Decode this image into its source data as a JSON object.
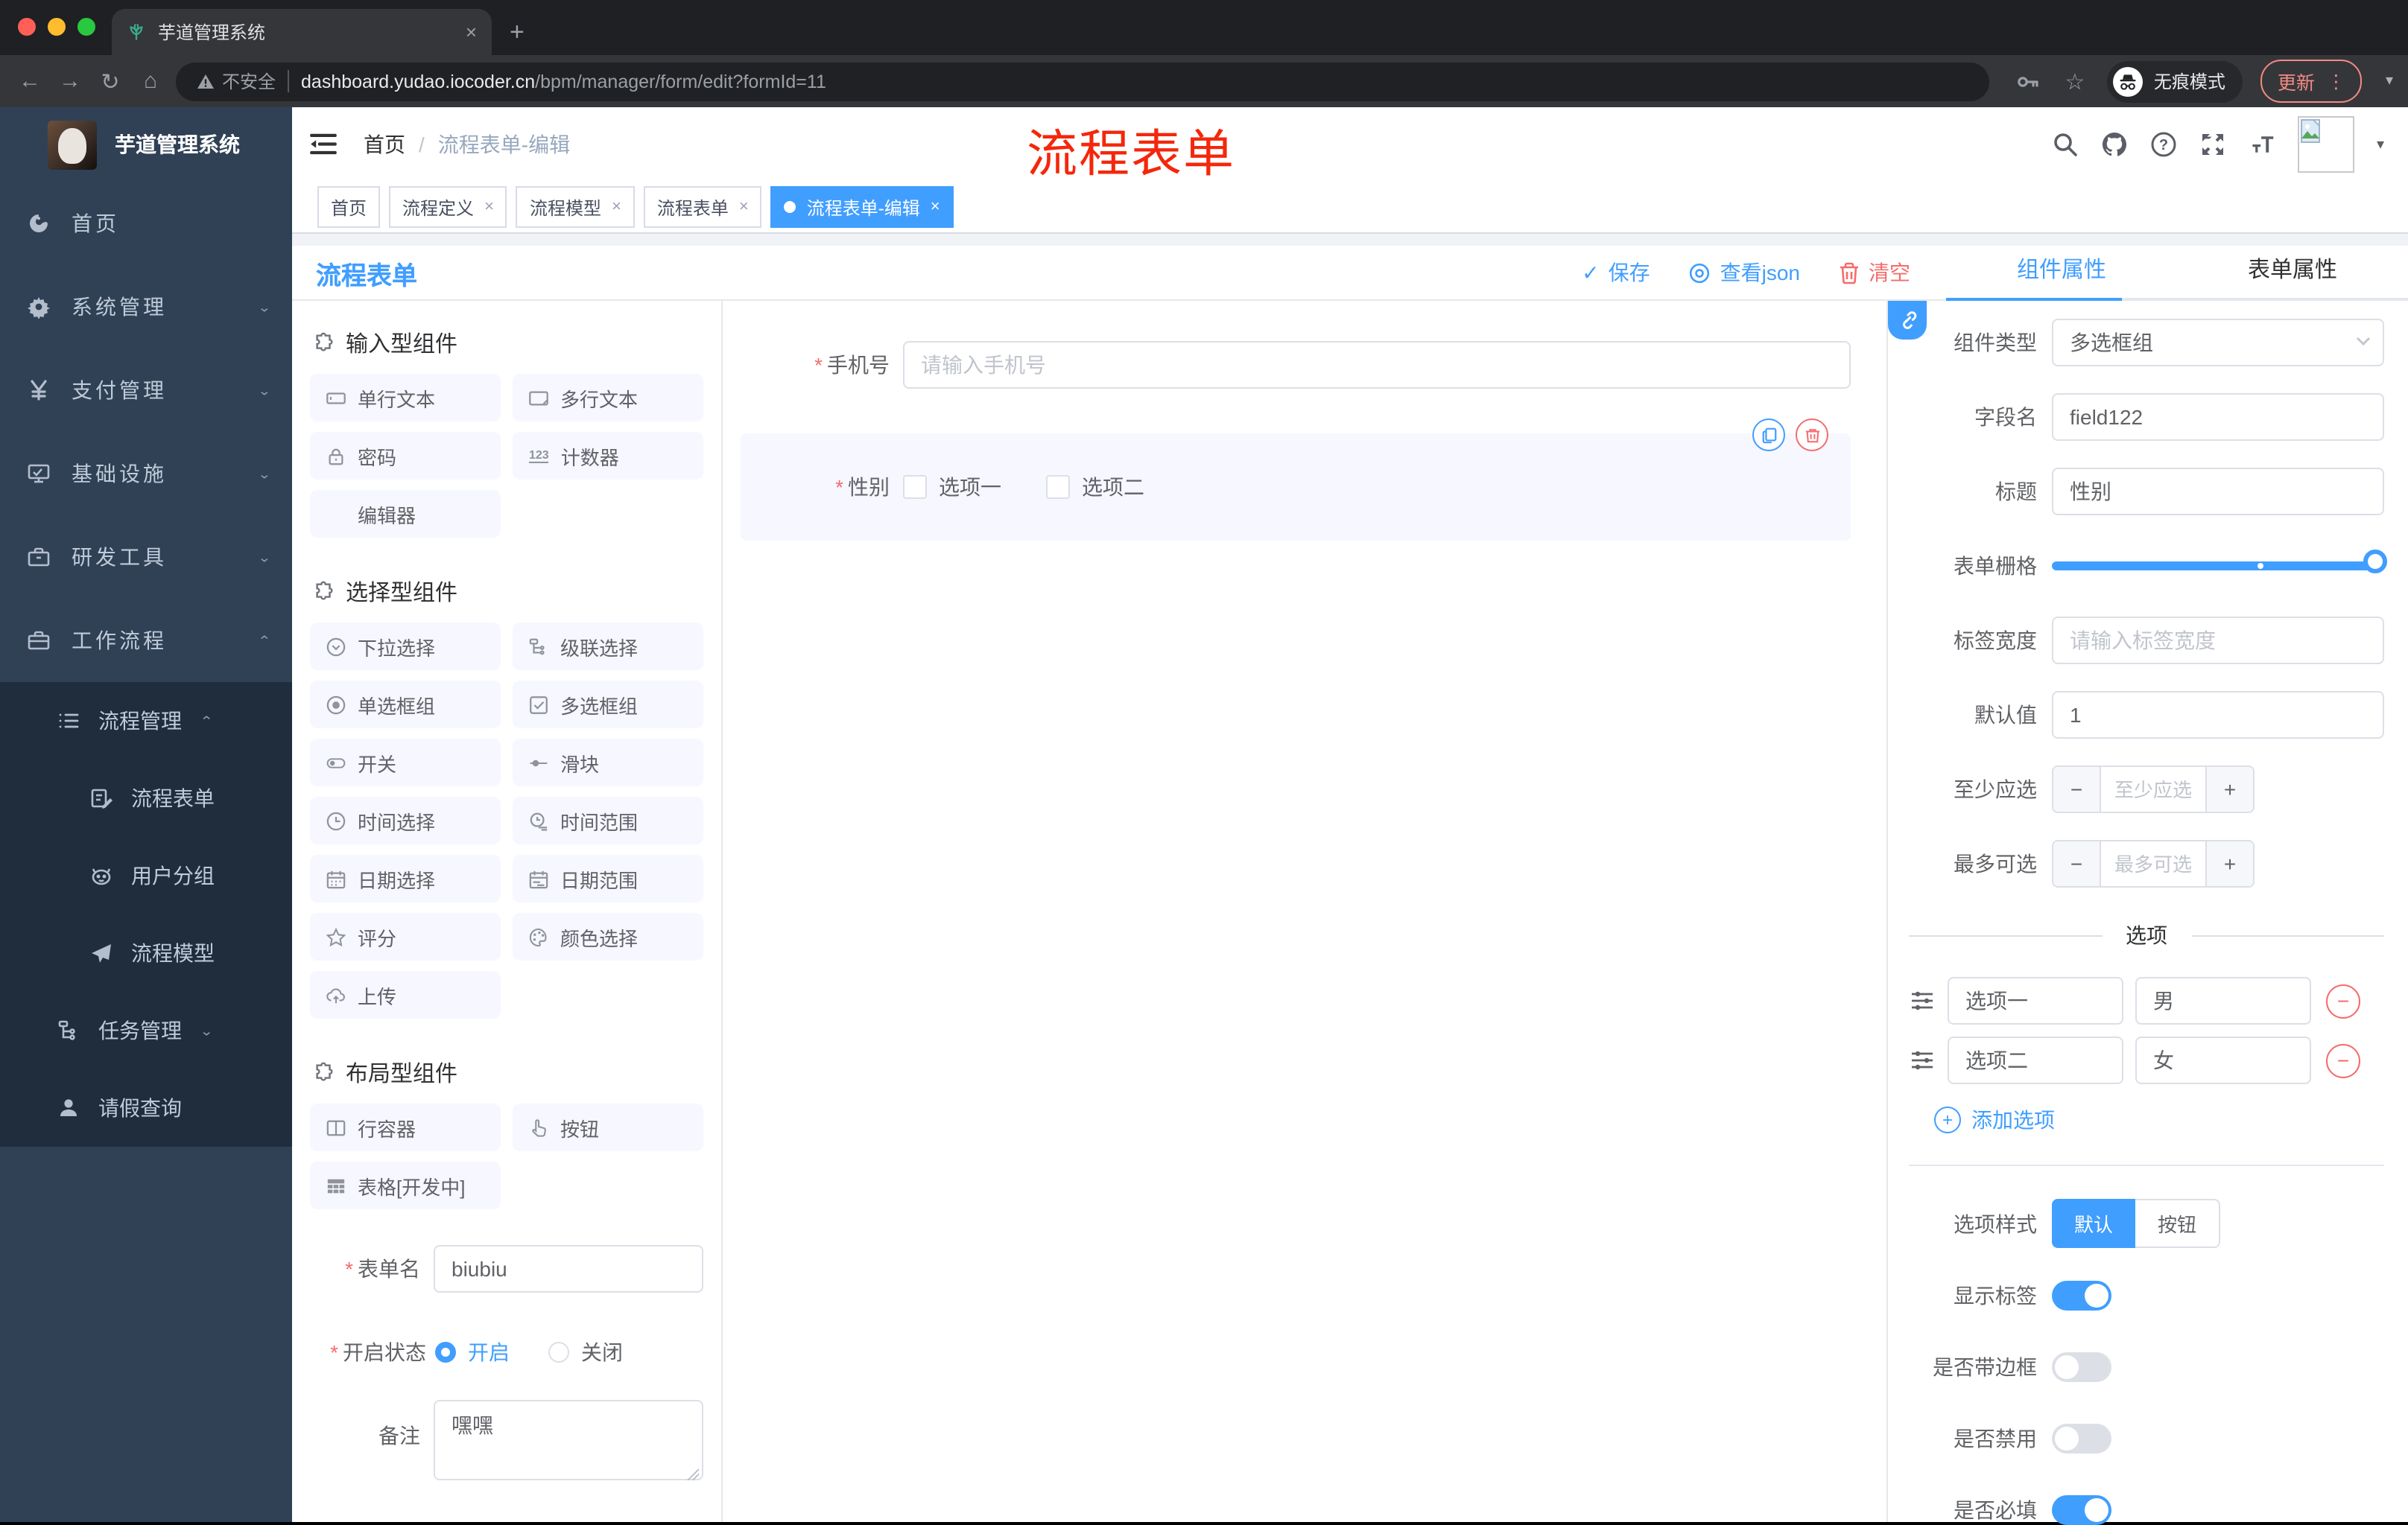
{
  "glyphs": {
    "close": "×",
    "plus": "+",
    "minus": "−",
    "required": "*",
    "caret_down": "▾",
    "star": "☆",
    "kebab": "⋮",
    "check": "✓",
    "slash": "/",
    "counter": "123",
    "question": "?",
    "back": "←",
    "forward": "→",
    "reload": "↻",
    "home": "⌂"
  },
  "browser": {
    "tab_title": "芋道管理系统",
    "security_label": "不安全",
    "url_domain": "dashboard.yudao.iocoder.cn",
    "url_path": "/bpm/manager/form/edit?formId=11",
    "incognito_label": "无痕模式",
    "update_label": "更新"
  },
  "sidebar": {
    "title": "芋道管理系统",
    "menu": [
      {
        "label": "首页"
      },
      {
        "label": "系统管理"
      },
      {
        "label": "支付管理"
      },
      {
        "label": "基础设施"
      },
      {
        "label": "研发工具"
      },
      {
        "label": "工作流程"
      }
    ],
    "submenu": {
      "group": "流程管理",
      "children": [
        {
          "label": "流程表单"
        },
        {
          "label": "用户分组"
        },
        {
          "label": "流程模型"
        }
      ],
      "tasks": "任务管理",
      "leave": "请假查询"
    }
  },
  "navbar": {
    "breadcrumb_home": "首页",
    "breadcrumb_current": "流程表单-编辑",
    "annotation": "流程表单",
    "annotation_color": "#f4270b"
  },
  "tags": [
    {
      "label": "首页"
    },
    {
      "label": "流程定义"
    },
    {
      "label": "流程模型"
    },
    {
      "label": "流程表单"
    },
    {
      "label": "流程表单-编辑"
    }
  ],
  "toolbar": {
    "title": "流程表单",
    "save": "保存",
    "view_json": "查看json",
    "clear": "清空"
  },
  "panel_tabs": {
    "component": "组件属性",
    "form": "表单属性"
  },
  "components": {
    "sections": [
      {
        "title": "输入型组件",
        "items": [
          {
            "label": "单行文本"
          },
          {
            "label": "多行文本"
          },
          {
            "label": "密码"
          },
          {
            "label": "计数器"
          },
          {
            "label": "编辑器"
          }
        ]
      },
      {
        "title": "选择型组件",
        "items": [
          {
            "label": "下拉选择"
          },
          {
            "label": "级联选择"
          },
          {
            "label": "单选框组"
          },
          {
            "label": "多选框组"
          },
          {
            "label": "开关"
          },
          {
            "label": "滑块"
          },
          {
            "label": "时间选择"
          },
          {
            "label": "时间范围"
          },
          {
            "label": "日期选择"
          },
          {
            "label": "日期范围"
          },
          {
            "label": "评分"
          },
          {
            "label": "颜色选择"
          },
          {
            "label": "上传"
          }
        ]
      },
      {
        "title": "布局型组件",
        "items": [
          {
            "label": "行容器"
          },
          {
            "label": "按钮"
          },
          {
            "label": "表格[开发中]"
          }
        ]
      }
    ],
    "form": {
      "name_label": "表单名",
      "name_value": "biubiu",
      "status_label": "开启状态",
      "status_on": "开启",
      "status_off": "关闭",
      "remark_label": "备注",
      "remark_value": "嘿嘿"
    }
  },
  "canvas": {
    "phone": {
      "label": "手机号",
      "placeholder": "请输入手机号"
    },
    "gender": {
      "label": "性别",
      "option1": "选项一",
      "option2": "选项二"
    }
  },
  "properties": {
    "component_type_label": "组件类型",
    "component_type_value": "多选框组",
    "field_name_label": "字段名",
    "field_name_value": "field122",
    "title_label": "标题",
    "title_value": "性别",
    "grid_label": "表单栅格",
    "label_width_label": "标签宽度",
    "label_width_placeholder": "请输入标签宽度",
    "default_label": "默认值",
    "default_value": "1",
    "min_label": "至少应选",
    "min_placeholder": "至少应选",
    "max_label": "最多可选",
    "max_placeholder": "最多可选",
    "options_divider": "选项",
    "options": [
      {
        "label": "选项一",
        "value": "男"
      },
      {
        "label": "选项二",
        "value": "女"
      }
    ],
    "add_option": "添加选项",
    "style_label": "选项样式",
    "style_default": "默认",
    "style_button": "按钮",
    "toggles": [
      {
        "label": "显示标签",
        "state": "on"
      },
      {
        "label": "是否带边框",
        "state": "off"
      },
      {
        "label": "是否禁用",
        "state": "off"
      },
      {
        "label": "是否必填",
        "state": "on"
      }
    ]
  },
  "colors": {
    "primary": "#409eff",
    "danger": "#f56c6c",
    "sidebar_bg": "#304156",
    "submenu_bg": "#1f2d3d"
  }
}
